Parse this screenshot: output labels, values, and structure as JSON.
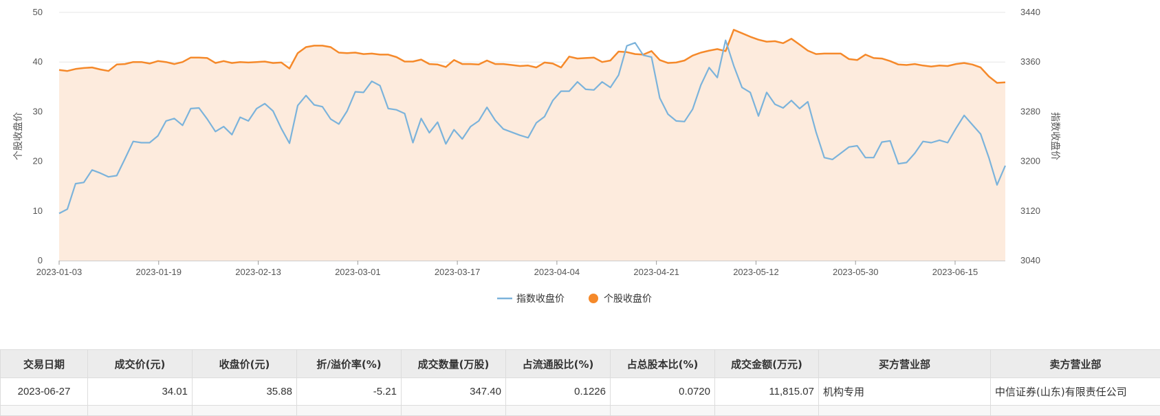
{
  "chart_data": {
    "type": "line",
    "x_ticks": [
      "2023-01-03",
      "2023-01-19",
      "2023-02-13",
      "2023-03-01",
      "2023-03-17",
      "2023-04-04",
      "2023-04-21",
      "2023-05-12",
      "2023-05-30",
      "2023-06-15"
    ],
    "y_left": {
      "label": "个股收盘价",
      "ticks": [
        0,
        10,
        20,
        30,
        40,
        50
      ],
      "range": [
        0,
        50
      ]
    },
    "y_right": {
      "label": "指数收盘价",
      "ticks": [
        3040,
        3120,
        3200,
        3280,
        3360,
        3440
      ],
      "range": [
        3040,
        3440
      ]
    },
    "series": [
      {
        "name": "指数收盘价",
        "axis": "right",
        "color": "#7bb3db",
        "fill": false,
        "values": [
          3116,
          3123,
          3164,
          3166,
          3186,
          3181,
          3175,
          3177,
          3204,
          3232,
          3230,
          3230,
          3241,
          3265,
          3269,
          3258,
          3285,
          3286,
          3268,
          3248,
          3256,
          3243,
          3271,
          3265,
          3285,
          3293,
          3281,
          3253,
          3229,
          3290,
          3306,
          3291,
          3288,
          3268,
          3260,
          3281,
          3312,
          3311,
          3329,
          3322,
          3285,
          3283,
          3277,
          3230,
          3269,
          3246,
          3263,
          3228,
          3251,
          3236,
          3256,
          3265,
          3287,
          3266,
          3252,
          3247,
          3242,
          3238,
          3262,
          3272,
          3298,
          3313,
          3313,
          3328,
          3316,
          3315,
          3328,
          3319,
          3339,
          3386,
          3391,
          3371,
          3368,
          3302,
          3276,
          3265,
          3264,
          3284,
          3323,
          3351,
          3335,
          3395,
          3354,
          3319,
          3311,
          3273,
          3311,
          3292,
          3286,
          3298,
          3285,
          3296,
          3247,
          3206,
          3203,
          3213,
          3223,
          3225,
          3206,
          3206,
          3231,
          3233,
          3196,
          3198,
          3213,
          3232,
          3230,
          3234,
          3230,
          3253,
          3274,
          3259,
          3244,
          3206,
          3162,
          3193
        ]
      },
      {
        "name": "个股收盘价",
        "axis": "left",
        "color": "#f5892a",
        "fill": true,
        "fill_color": "#fdebdd",
        "values": [
          38.4,
          38.2,
          38.6,
          38.8,
          38.9,
          38.5,
          38.2,
          39.5,
          39.6,
          40.0,
          40.0,
          39.7,
          40.2,
          40.0,
          39.6,
          40.0,
          40.9,
          40.9,
          40.8,
          39.8,
          40.2,
          39.8,
          40.0,
          39.9,
          40.0,
          40.1,
          39.8,
          39.9,
          38.7,
          41.8,
          43.0,
          43.3,
          43.3,
          43.0,
          41.9,
          41.8,
          41.9,
          41.6,
          41.7,
          41.5,
          41.5,
          41.0,
          40.1,
          40.1,
          40.5,
          39.6,
          39.5,
          39.0,
          40.4,
          39.6,
          39.6,
          39.5,
          40.3,
          39.6,
          39.6,
          39.4,
          39.2,
          39.3,
          38.9,
          39.9,
          39.7,
          38.9,
          41.1,
          40.7,
          40.8,
          40.9,
          40.0,
          40.3,
          42.1,
          42.0,
          41.6,
          41.5,
          42.2,
          40.4,
          39.8,
          39.9,
          40.3,
          41.3,
          41.9,
          42.3,
          42.6,
          42.2,
          46.5,
          45.8,
          45.1,
          44.5,
          44.1,
          44.2,
          43.8,
          44.7,
          43.5,
          42.3,
          41.6,
          41.7,
          41.7,
          41.7,
          40.6,
          40.4,
          41.5,
          40.8,
          40.7,
          40.2,
          39.5,
          39.4,
          39.6,
          39.3,
          39.1,
          39.3,
          39.2,
          39.6,
          39.8,
          39.5,
          38.9,
          37.1,
          35.8,
          35.9
        ]
      }
    ],
    "grid": true,
    "legend": "bottom-center"
  },
  "table": {
    "headers": [
      "交易日期",
      "成交价(元)",
      "收盘价(元)",
      "折/溢价率(%)",
      "成交数量(万股)",
      "占流通股比(%)",
      "占总股本比(%)",
      "成交金额(万元)",
      "买方营业部",
      "卖方营业部"
    ],
    "rows": [
      [
        "2023-06-27",
        "34.01",
        "35.88",
        "-5.21",
        "347.40",
        "0.1226",
        "0.0720",
        "11,815.07",
        "机构专用",
        "中信证券(山东)有限责任公司"
      ]
    ]
  }
}
